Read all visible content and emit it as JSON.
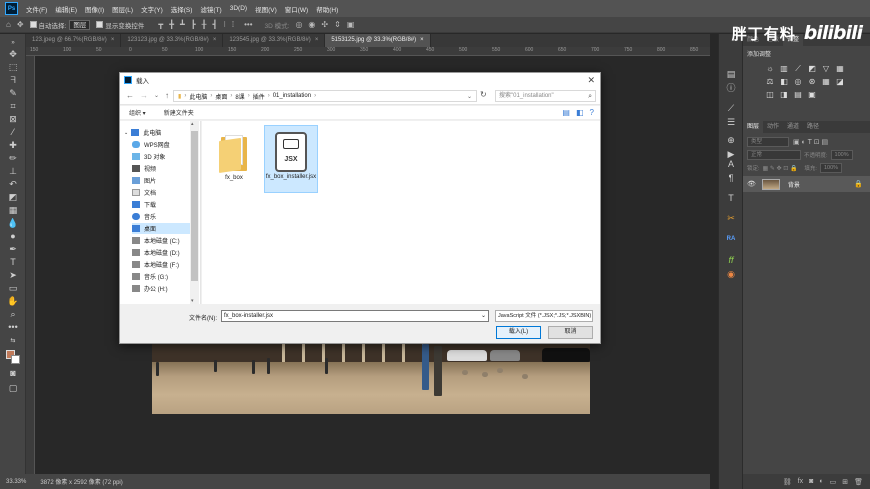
{
  "app": {
    "logo": "Ps"
  },
  "menu": [
    "文件(F)",
    "编辑(E)",
    "图像(I)",
    "图层(L)",
    "文字(Y)",
    "选择(S)",
    "滤镜(T)",
    "3D(D)",
    "视图(V)",
    "窗口(W)",
    "帮助(H)"
  ],
  "options": {
    "auto_select_label": "自动选择:",
    "auto_select_value": "图层",
    "show_transform_label": "显示变换控件",
    "mode_3d": "3D 模式:"
  },
  "doc_tabs": [
    {
      "label": "123.jpeg @ 66.7%(RGB/8#)"
    },
    {
      "label": "123123.jpg @ 33.3%(RGB/8#)"
    },
    {
      "label": "123545.jpg @ 33.3%(RGB/8#)"
    },
    {
      "label": "5153125.jpg @ 33.3%(RGB/8#)"
    }
  ],
  "ruler_ticks": [
    "150",
    "100",
    "50",
    "0",
    "50",
    "100",
    "150",
    "200",
    "250",
    "300",
    "350",
    "400",
    "450",
    "500",
    "550",
    "600",
    "650",
    "700",
    "750",
    "800",
    "850"
  ],
  "status": {
    "zoom": "33.33%",
    "size": "3872 像素 x 2592 像素 (72 ppi)"
  },
  "watermark": {
    "text": "胖丁有料",
    "logo": "bilibili"
  },
  "right_panel": {
    "adj_tabs": [
      "颜色",
      "色板",
      "调整"
    ],
    "adj_title": "添加调整",
    "layer_tabs": [
      "图层",
      "动作",
      "通道",
      "路径"
    ],
    "kind": "类型",
    "blend": "正常",
    "opacity_label": "不透明度:",
    "opacity_value": "100%",
    "lock_label": "锁定:",
    "fill_label": "填充:",
    "fill_value": "100%",
    "layer_name": "背景"
  },
  "dialog": {
    "title": "载入",
    "breadcrumbs": [
      "此电脑",
      "桌面",
      "8课",
      "插件",
      "01_installation"
    ],
    "search_placeholder": "搜索\"01_installation\"",
    "organize": "组织 ▾",
    "new_folder": "新建文件夹",
    "nav_items": [
      {
        "label": "此电脑",
        "icon": "computer-icon"
      },
      {
        "label": "WPS网盘",
        "icon": "cloud-icon"
      },
      {
        "label": "3D 对象",
        "icon": "cube-icon"
      },
      {
        "label": "视频",
        "icon": "video-icon"
      },
      {
        "label": "图片",
        "icon": "picture-icon"
      },
      {
        "label": "文档",
        "icon": "document-icon"
      },
      {
        "label": "下载",
        "icon": "download-icon"
      },
      {
        "label": "音乐",
        "icon": "music-icon"
      },
      {
        "label": "桌面",
        "icon": "desktop-icon"
      },
      {
        "label": "本地磁盘 (C:)",
        "icon": "drive-icon"
      },
      {
        "label": "本地磁盘 (D:)",
        "icon": "drive-icon"
      },
      {
        "label": "本地磁盘 (F:)",
        "icon": "drive-icon"
      },
      {
        "label": "音乐 (G:)",
        "icon": "drive-icon"
      },
      {
        "label": "办公 (H:)",
        "icon": "drive-icon"
      }
    ],
    "files": [
      {
        "name": "fx_box",
        "type": "folder"
      },
      {
        "name": "fx_box_installer.jsx",
        "type": "jsx",
        "badge": "JSX"
      }
    ],
    "filename_label": "文件名(N):",
    "filename_value": "fx_box-installer.jsx",
    "filetype": "JavaScript 文件 (*.JSX;*.JS;*.JSXBIN)",
    "load_button": "载入(L)",
    "cancel_button": "取消"
  }
}
